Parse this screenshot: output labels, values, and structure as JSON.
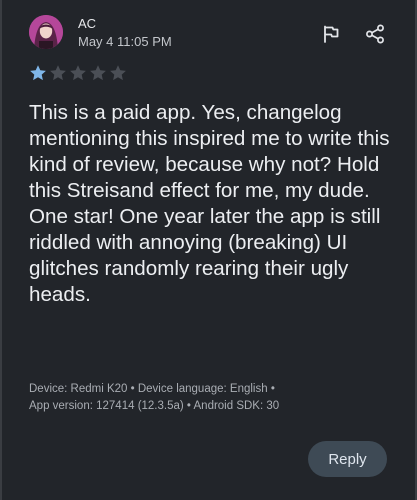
{
  "review": {
    "user_name": "AC",
    "date": "May 4 11:05 PM",
    "rating": 1,
    "rating_max": 5,
    "text": "This is a paid app. Yes, changelog mentioning this inspired me to write this kind of review, because why not? Hold this Streisand effect for me, my dude. One star! One year later the app is still riddled with annoying (breaking) UI glitches randomly rearing their ugly heads.",
    "meta_line1": "Device: Redmi K20 • Device language: English •",
    "meta_line2": "App version: 127414 (12.3.5a) • Android SDK: 30"
  },
  "actions": {
    "flag_icon": "flag-icon",
    "share_icon": "share-icon",
    "reply_label": "Reply"
  },
  "colors": {
    "background": "#22252a",
    "star_filled": "#7fb6e8",
    "star_empty": "#4b4f56",
    "reply_bg": "#3e4a55"
  }
}
